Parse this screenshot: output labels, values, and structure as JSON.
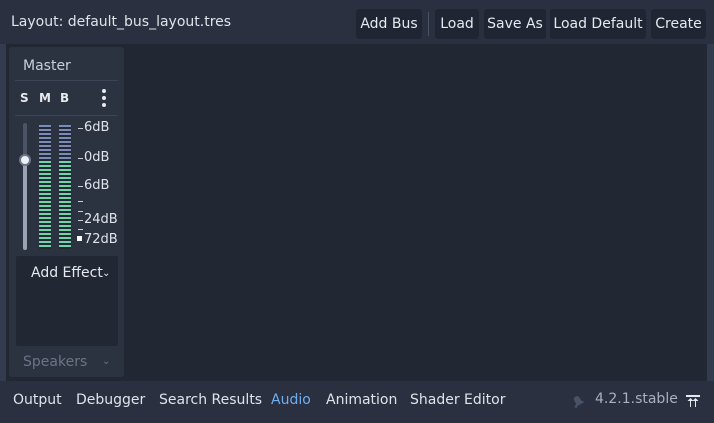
{
  "toolbar": {
    "layout_label": "Layout: default_bus_layout.tres",
    "add_bus": "Add Bus",
    "load": "Load",
    "save_as": "Save As",
    "load_default": "Load Default",
    "create": "Create"
  },
  "bus": {
    "name": "Master",
    "solo": "S",
    "mute": "M",
    "bypass": "B",
    "menu_icon": "kebab-menu-icon",
    "volume_db": 0,
    "scale_labels": [
      "6dB",
      "0dB",
      "6dB",
      "24dB",
      "72dB"
    ],
    "add_effect": "Add Effect",
    "output": "Speakers"
  },
  "bottom_tabs": [
    "Output",
    "Debugger",
    "Search Results",
    "Audio",
    "Animation",
    "Shader Editor"
  ],
  "active_tab": "Audio",
  "version": "4.2.1.stable",
  "colors": {
    "background": "#333b4f",
    "panel": "#222833",
    "accent": "#70aef0",
    "meter_green": "#6fd4a8",
    "meter_blue": "#7a8bb8"
  },
  "icons": {
    "notification": "notification-bell-icon",
    "pin": "pin-bottom-panel-icon"
  }
}
